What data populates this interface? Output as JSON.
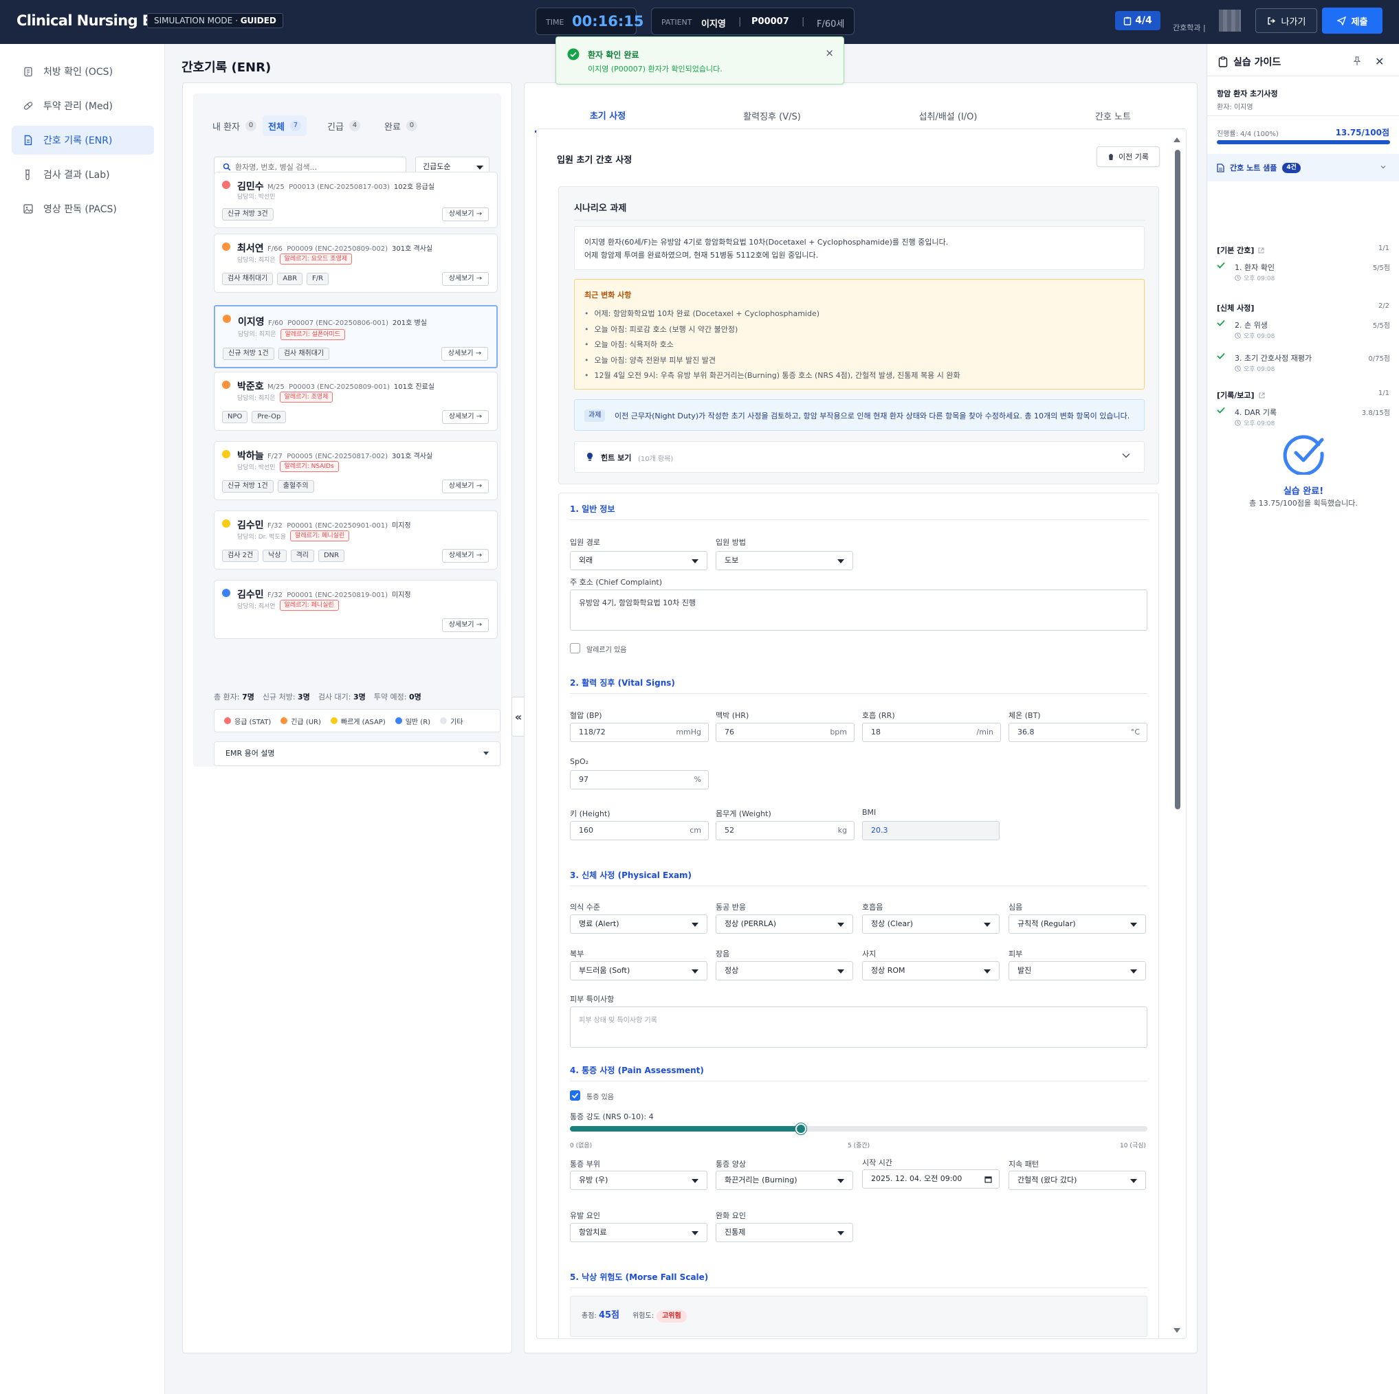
{
  "app": {
    "title": "Clinical Nursing EMR",
    "mode_label": "SIMULATION MODE · ",
    "mode_value": "GUIDED"
  },
  "timer": {
    "label": "TIME",
    "value": "00:16:15"
  },
  "patient_bar": {
    "label": "PATIENT",
    "name": "이지영",
    "sep1": "|",
    "id": "P00007",
    "sep2": "|",
    "demo": "F/60세"
  },
  "progress_badge": "4/4",
  "user": {
    "label": "간호학과 |"
  },
  "buttons": {
    "exit": "나가기",
    "submit": "제출"
  },
  "sidebar": {
    "items": [
      {
        "label": "처방 확인 (OCS)",
        "icon": "clipboard-icon"
      },
      {
        "label": "투약 관리 (Med)",
        "icon": "pill-icon"
      },
      {
        "label": "간호 기록 (ENR)",
        "icon": "document-icon",
        "active": true
      },
      {
        "label": "검사 결과 (Lab)",
        "icon": "test-tube-icon"
      },
      {
        "label": "영상 판독 (PACS)",
        "icon": "image-icon"
      }
    ]
  },
  "page_title": "간호기록 (ENR)",
  "patient_list": {
    "tabs": [
      {
        "label": "내 환자",
        "count": "0"
      },
      {
        "label": "전체",
        "count": "7",
        "active": true
      },
      {
        "label": "긴급",
        "count": "4"
      },
      {
        "label": "완료",
        "count": "0"
      }
    ],
    "search_placeholder": "환자명, 번호, 병실 검색...",
    "sort_value": "긴급도순",
    "detail_label": "상세보기 →",
    "patients": [
      {
        "name": "김민수",
        "demo": "M/25",
        "id": "P00013 (ENC-20250817-003)",
        "room": "102호 응급실",
        "nurse": "담당의: 박선민",
        "allergy": "",
        "tags": [
          "신규 처방 3건"
        ],
        "dot": "#f87171"
      },
      {
        "name": "최서연",
        "demo": "F/66",
        "id": "P00009 (ENC-20250809-002)",
        "room": "301호 격사실",
        "nurse": "담당의: 최지은",
        "allergy": "알레르기: 요오드 조영제",
        "tags": [
          "검사 채취대기",
          "ABR",
          "F/R"
        ],
        "dot": "#fb923c"
      },
      {
        "name": "이지영",
        "demo": "F/60",
        "id": "P00007 (ENC-20250806-001)",
        "room": "201호 병실",
        "nurse": "담당의: 최지은",
        "allergy": "알레르기: 설폰아미드",
        "tags": [
          "신규 처방 1건",
          "검사 채취대기"
        ],
        "dot": "#fb923c",
        "selected": true
      },
      {
        "name": "박준호",
        "demo": "M/25",
        "id": "P00003 (ENC-20250809-001)",
        "room": "101호 진료실",
        "nurse": "담당의: 최지은",
        "allergy": "알레르기: 조영제",
        "tags": [
          "NPO",
          "Pre-Op"
        ],
        "dot": "#fb923c"
      },
      {
        "name": "박하늘",
        "demo": "F/27",
        "id": "P00005 (ENC-20250817-002)",
        "room": "301호 격사실",
        "nurse": "담당의: 박선민",
        "allergy": "알레르기: NSAIDs",
        "tags": [
          "신규 처방 1건",
          "출혈주의"
        ],
        "dot": "#facc15"
      },
      {
        "name": "김수민",
        "demo": "F/32",
        "id": "P00001 (ENC-20250901-001)",
        "room": "미지정",
        "nurse": "담당의: Dr. 박도윤",
        "allergy": "알레르기: 페니실린",
        "tags": [
          "검사 2건",
          "낙상",
          "격리",
          "DNR"
        ],
        "dot": "#facc15"
      },
      {
        "name": "김수민",
        "demo": "F/32",
        "id": "P00001 (ENC-20250819-001)",
        "room": "미지정",
        "nurse": "담당의: 최서연",
        "allergy": "알레르기: 페니실린",
        "tags": [],
        "dot": "#3b82f6"
      }
    ],
    "stats": [
      {
        "label": "총 환자:",
        "value": "7명"
      },
      {
        "label": "신규 처방:",
        "value": "3명"
      },
      {
        "label": "검사 대기:",
        "value": "3명"
      },
      {
        "label": "투약 예정:",
        "value": "0명"
      }
    ],
    "legend": [
      {
        "label": "응급 (STAT)",
        "color": "#f87171"
      },
      {
        "label": "긴급 (UR)",
        "color": "#fb923c"
      },
      {
        "label": "빠르게 (ASAP)",
        "color": "#facc15"
      },
      {
        "label": "일반 (R)",
        "color": "#3b82f6"
      },
      {
        "label": "기타",
        "color": "#e5e7eb"
      }
    ],
    "glossary": "EMR 용어 설명",
    "collapse": "«"
  },
  "toast": {
    "title": "환자 확인 완료",
    "message": "이지영 (P00007) 환자가 확인되었습니다.",
    "close": "×"
  },
  "center": {
    "tabs": [
      "초기 사정",
      "활력징후 (V/S)",
      "섭취/배설 (I/O)",
      "간호 노트"
    ],
    "form_title": "입원 초기 간호 사정",
    "prev_button": "이전 기록",
    "scenario": {
      "title": "시나리오 과제",
      "desc1": "이지영 환자(60세/F)는 유방암 4기로 항암화학요법 10차(Docetaxel + Cyclophosphamide)를 진행 중입니다.",
      "desc2": "어제 항암제 투여를 완료하였으며, 현재 51병동 5112호에 입원 중입니다.",
      "changes_title": "최근 변화 사항",
      "changes": [
        "어제: 항암화학요법 10차 완료 (Docetaxel + Cyclophosphamide)",
        "오늘 아침: 피로감 호소 (보행 시 약간 불안정)",
        "오늘 아침: 식욕저하 호소",
        "오늘 아침: 양측 전완부 피부 발진 발견",
        "12월 4일 오전 9시: 우측 유방 부위 화끈거리는(Burning) 통증 호소 (NRS 4점), 간헐적 발생, 진통제 복용 시 완화"
      ],
      "task_badge": "과제",
      "task_text": "이전 근무자(Night Duty)가 작성한 초기 사정을 검토하고, 항암 부작용으로 인해 현재 환자 상태와 다른 항목을 찾아 수정하세요. 총 10개의 변화 항목이 있습니다.",
      "hint_title": "힌트 보기",
      "hint_sub": "(10개 항목)"
    },
    "s1": {
      "title": "1. 일반 정보",
      "admit_route_label": "입원 경로",
      "admit_route": "외래",
      "admit_method_label": "입원 방법",
      "admit_method": "도보",
      "cc_label": "주 호소 (Chief Complaint)",
      "cc": "유방암 4기, 항암화학요법 10차 진행",
      "allergy_label": "알레르기 있음"
    },
    "s2": {
      "title": "2. 활력 징후 (Vital Signs)",
      "bp_label": "혈압 (BP)",
      "bp": "118/72",
      "bp_unit": "mmHg",
      "hr_label": "맥박 (HR)",
      "hr": "76",
      "hr_unit": "bpm",
      "rr_label": "호흡 (RR)",
      "rr": "18",
      "rr_unit": "/min",
      "bt_label": "체온 (BT)",
      "bt": "36.8",
      "bt_unit": "°C",
      "spo2_label": "SpO₂",
      "spo2": "97",
      "spo2_unit": "%",
      "ht_label": "키 (Height)",
      "ht": "160",
      "ht_unit": "cm",
      "wt_label": "몸무게 (Weight)",
      "wt": "52",
      "wt_unit": "kg",
      "bmi_label": "BMI",
      "bmi": "20.3"
    },
    "s3": {
      "title": "3. 신체 사정 (Physical Exam)",
      "loc_label": "의식 수준",
      "loc": "명료 (Alert)",
      "pupil_label": "동공 반응",
      "pupil": "정상 (PERRLA)",
      "breath_label": "호흡음",
      "breath": "정상 (Clear)",
      "heart_label": "심음",
      "heart": "규칙적 (Regular)",
      "abd_label": "복부",
      "abd": "부드러움 (Soft)",
      "bowel_label": "장음",
      "bowel": "정상",
      "limb_label": "사지",
      "limb": "정상 ROM",
      "skin_label": "피부",
      "skin": "발진",
      "skin_note_label": "피부 특이사항",
      "skin_note_ph": "피부 상태 및 특이사항 기록"
    },
    "s4": {
      "title": "4. 통증 사정 (Pain Assessment)",
      "pain_yes": "통증 있음",
      "intensity_label": "통증 강도 (NRS 0-10): 4",
      "intensity": 4,
      "tick0": "0 (없음)",
      "tick5": "5 (중간)",
      "tick10": "10 (극심)",
      "site_label": "통증 부위",
      "site": "유방 (우)",
      "quality_label": "통증 양상",
      "quality": "화끈거리는 (Burning)",
      "onset_label": "시작 시간",
      "onset": "2025. 12. 04. 오전 09:00",
      "pattern_label": "지속 패턴",
      "pattern": "간헐적 (왔다 갔다)",
      "aggr_label": "유발 요인",
      "aggr": "항암치료",
      "relief_label": "완화 요인",
      "relief": "진통제"
    },
    "s5": {
      "title": "5. 낙상 위험도 (Morse Fall Scale)",
      "total_label": "총점:",
      "total": "45점",
      "risk_label": "위험도:",
      "risk": "고위험"
    }
  },
  "guide": {
    "title": "실습 가이드",
    "scenario": "항암 환자 초기사정",
    "patient": "환자: 이지영",
    "progress_label": "진행률: 4/4 (100%)",
    "progress_score": "13.75/100점",
    "progress_pct": 100,
    "sample_label": "간호 노트 샘플",
    "sample_count": "4건",
    "groups": [
      {
        "title": "[기본 간호]",
        "count": "1/1",
        "items": [
          {
            "name": "1. 환자 확인",
            "time": "오후 09:08",
            "score": "5/5점"
          }
        ]
      },
      {
        "title": "[신체 사정]",
        "count": "2/2",
        "items": [
          {
            "name": "2. 손 위생",
            "time": "오후 09:08",
            "score": "5/5점"
          },
          {
            "name": "3. 초기 간호사정 재평가",
            "time": "오후 09:08",
            "score": "0/75점"
          }
        ]
      },
      {
        "title": "[기록/보고]",
        "count": "1/1",
        "items": [
          {
            "name": "4. DAR 기록",
            "time": "오후 09:08",
            "score": "3.8/15점"
          }
        ]
      }
    ],
    "done_title": "실습 완료!",
    "done_sub": "총 13.75/100점을 획득했습니다."
  },
  "colors": {
    "accent": "#1d4ed8",
    "topbar": "#1b2740",
    "success": "#16a34a",
    "slider": "#19807d"
  }
}
